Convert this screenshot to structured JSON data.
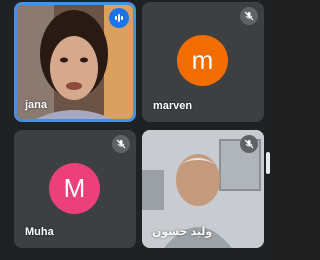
{
  "colors": {
    "background": "#202124",
    "tile": "#3c4043",
    "active_border": "#4a90e2",
    "speaking_badge": "#1a73e8",
    "mute_badge": "#5f6368"
  },
  "participants": [
    {
      "name": "jana",
      "tile_type": "video",
      "speaking": true,
      "muted": false
    },
    {
      "name": "marven",
      "tile_type": "avatar",
      "avatar_letter": "m",
      "avatar_color": "#f26c00",
      "muted": true
    },
    {
      "name": "Muha",
      "tile_type": "avatar",
      "avatar_letter": "M",
      "avatar_color": "#ec407a",
      "muted": true
    },
    {
      "name": "وليد حسون",
      "tile_type": "video",
      "speaking": false,
      "muted": true
    }
  ]
}
